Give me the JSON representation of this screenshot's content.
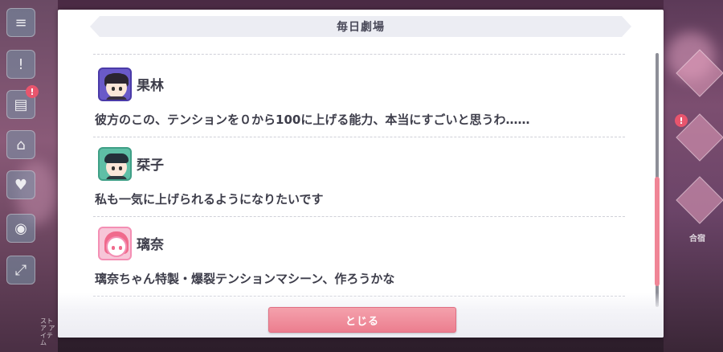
{
  "dialog": {
    "title": "毎日劇場",
    "close_label": "とじる"
  },
  "entries": [
    {
      "name": "果林",
      "text": "彼方のこの、テンションを０から100に上げる能力、本当にすごいと思うわ……",
      "avatar_color": "#6a5ac8"
    },
    {
      "name": "栞子",
      "text": "私も一気に上げられるようになりたいです",
      "avatar_color": "#5fbfa6"
    },
    {
      "name": "璃奈",
      "text": "璃奈ちゃん特製・爆裂テンションマシーン、作ろうかな",
      "avatar_color": "#f48fb4"
    }
  ],
  "background": {
    "notif_1": "!",
    "notif_2": "!",
    "side_label": "ストア アイテム",
    "right_label": "合宿"
  },
  "colors": {
    "accent": "#ec7e8f",
    "scroll_thumb": "#f08596",
    "title_bar": "#ecedf3"
  }
}
